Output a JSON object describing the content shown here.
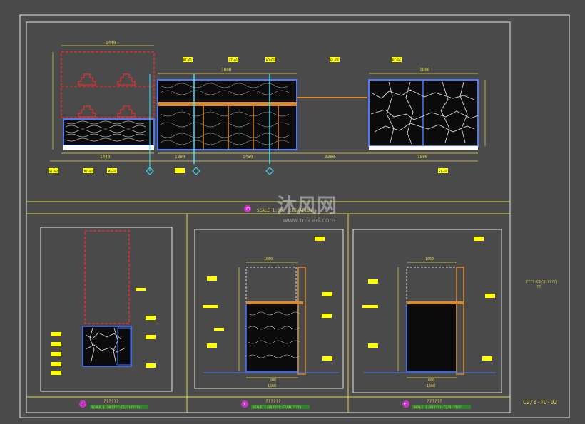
{
  "colors": {
    "background": "#4a4a4a",
    "frame": "#e6e6e6",
    "title_line": "#e3d54a",
    "tag_fill": "#ffff00",
    "red_dash": "#e03030",
    "blue_edge": "#4a78ff",
    "cyan": "#31e5ff",
    "orange": "#d98a2a",
    "panel_black": "#0b0b0b"
  },
  "top_panel": {
    "section_mark": "C2",
    "section_title": "ELEVATION",
    "section_scale": "SCALE 1:30",
    "dimensions": {
      "left_width": "1440",
      "center_top": "3000",
      "right_width": "1800",
      "bottom_total_left": "1440",
      "bottom_mid_a": "1300",
      "bottom_mid_b": "1450",
      "bottom_right_a": "3300",
      "bottom_right_b": "1800"
    },
    "tags": [
      "MT-01",
      "ST-01",
      "WD-01",
      "GL-01",
      "PT-01",
      "ST-02",
      "MT-02",
      "WD-02",
      "ST-03"
    ]
  },
  "bottom_panels": [
    {
      "id": "left",
      "mark": "C",
      "title": "??????",
      "scale": "SCALE 1:10",
      "ref": "????-C2/3(????)"
    },
    {
      "id": "middle",
      "mark": "D",
      "title": "??????",
      "scale": "SCALE 1:10",
      "ref": "????-C2/3(????)",
      "dimensions": {
        "top": "1660",
        "bottom_a": "600",
        "bottom_b": "1660"
      }
    },
    {
      "id": "right",
      "mark": "E",
      "title": "??????",
      "scale": "SCALE 1:10",
      "ref": "????-C2/3(????)",
      "dimensions": {
        "top": "1660",
        "bottom_a": "600",
        "bottom_b": "1660"
      }
    }
  ],
  "side_note": {
    "line1": "????-C2/3(????)",
    "line2": "??"
  },
  "sheet_number": "C2/3-FD-02",
  "watermark": {
    "brand": "沐风网",
    "url": "www.mfcad.com"
  }
}
